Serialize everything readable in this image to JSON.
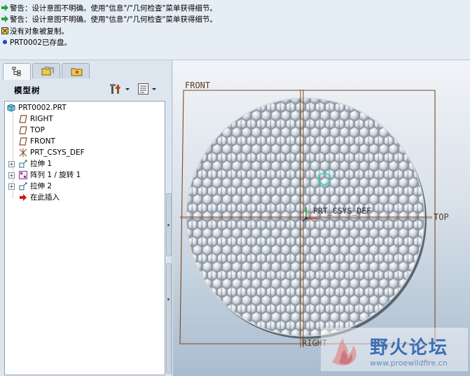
{
  "messages": [
    {
      "icon": "green-arrow-icon",
      "text": "警告：设计意图不明确。使用\"信息\"/\"几何检查\"菜单获得细节。"
    },
    {
      "icon": "green-arrow-icon",
      "text": "警告：设计意图不明确。使用\"信息\"/\"几何检查\"菜单获得细节。"
    },
    {
      "icon": "warning-box-icon",
      "text": "没有对象被复制。"
    },
    {
      "icon": "blue-dot-icon",
      "text": "PRT0002已存盘。"
    }
  ],
  "left_panel": {
    "tabs": [
      {
        "name": "model-tree-tab-icon"
      },
      {
        "name": "folder-browser-tab-icon"
      },
      {
        "name": "favorites-tab-icon"
      }
    ],
    "tree_title": "模型树",
    "tools": [
      "settings-icon",
      "show-icon"
    ]
  },
  "tree": {
    "root": "PRT0002.PRT",
    "items": [
      {
        "label": "RIGHT",
        "icon": "datum-plane-icon"
      },
      {
        "label": "TOP",
        "icon": "datum-plane-icon"
      },
      {
        "label": "FRONT",
        "icon": "datum-plane-icon"
      },
      {
        "label": "PRT_CSYS_DEF",
        "icon": "csys-icon"
      },
      {
        "label": "拉伸 1",
        "icon": "extrude-icon"
      },
      {
        "label": "阵列 1 / 旋转 1",
        "icon": "pattern-icon"
      },
      {
        "label": "拉伸 2",
        "icon": "extrude-icon"
      },
      {
        "label": "在此插入",
        "icon": "insert-here-icon"
      }
    ]
  },
  "viewport": {
    "front_label": "FRONT",
    "top_label": "TOP",
    "right_label": "RIGHT",
    "csys_label": "PRT_CSYS_DEF",
    "datum_color": "#7a4a22",
    "bg_top": "#f1f4f8",
    "bg_bottom": "#a9bccf"
  },
  "watermark": {
    "title": "野火论坛",
    "url": "www.proewildfire.cn"
  }
}
